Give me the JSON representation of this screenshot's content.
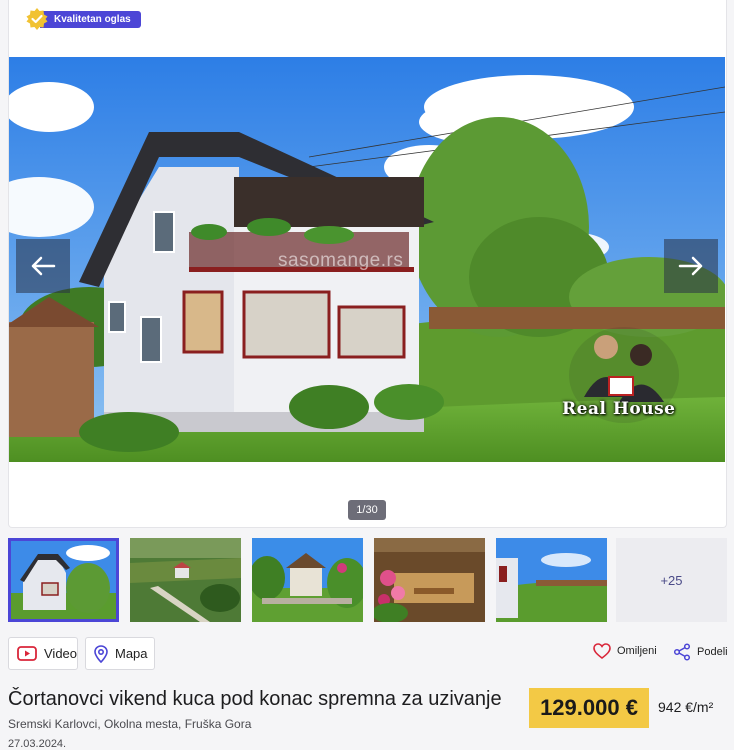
{
  "badge": {
    "label": "Kvalitetan oglas",
    "icon": "verified-seal-icon",
    "color": "#4c46d6",
    "seal_color": "#f1c232"
  },
  "gallery": {
    "counter": "1/30",
    "watermark": "sasomange.rs",
    "more_label": "+25",
    "brand_label": "Real House",
    "thumbnails": [
      {
        "name": "thumb-house-front",
        "active": true
      },
      {
        "name": "thumb-aerial-view",
        "active": false
      },
      {
        "name": "thumb-garden-pergola",
        "active": false
      },
      {
        "name": "thumb-flowers-terrace",
        "active": false
      },
      {
        "name": "thumb-hillside-fence",
        "active": false
      }
    ]
  },
  "actions": {
    "video_label": "Video",
    "map_label": "Mapa",
    "favorite_label": "Omiljeni",
    "share_label": "Podeli"
  },
  "listing": {
    "title": "Čortanovci vikend kuca pod konac spremna za uzivanje",
    "location": "Sremski Karlovci, Okolna mesta, Fruška Gora",
    "date": "27.03.2024.",
    "price": "129.000 €",
    "price_per_m2": "942 €/m²",
    "price_color": "#f3c945"
  }
}
